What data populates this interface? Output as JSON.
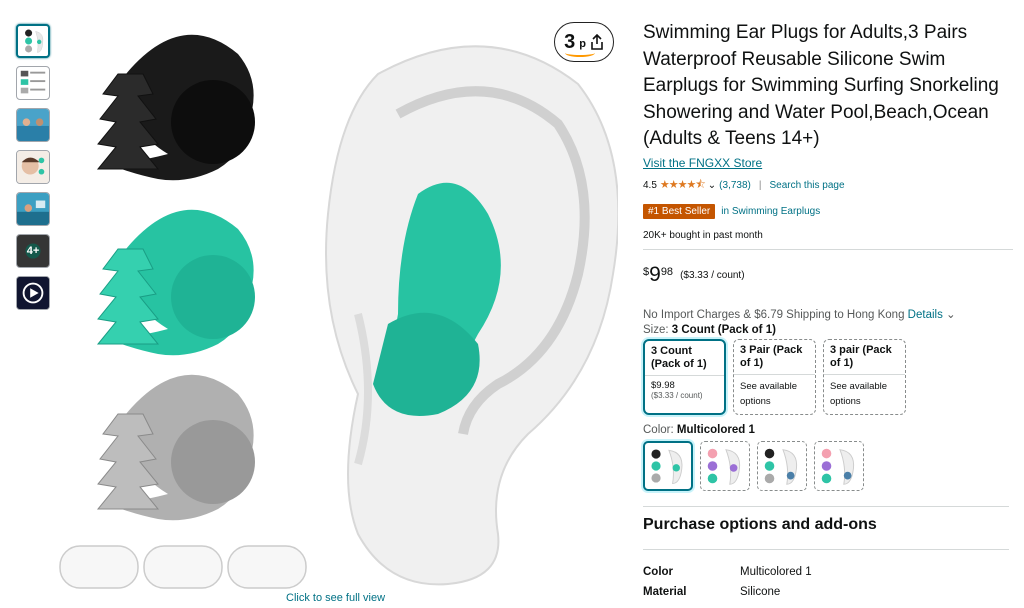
{
  "thumbnails": [
    {
      "name": "thumbnail-1",
      "type": "image"
    },
    {
      "name": "thumbnail-2",
      "type": "image"
    },
    {
      "name": "thumbnail-3",
      "type": "image"
    },
    {
      "name": "thumbnail-4",
      "type": "image"
    },
    {
      "name": "thumbnail-5",
      "type": "image"
    },
    {
      "name": "thumbnail-more",
      "type": "more",
      "label": "4+"
    },
    {
      "name": "thumbnail-video",
      "type": "video"
    }
  ],
  "main_image": {
    "see_full_label": "Click to see full view",
    "share_count": "3",
    "share_suffix": "p"
  },
  "product": {
    "title": "Swimming Ear Plugs for Adults,3 Pairs Waterproof Reusable Silicone Swim Earplugs for Swimming Surfing Snorkeling Showering and Water Pool,Beach,Ocean (Adults & Teens 14+)",
    "store_link": "Visit the FNGXX Store",
    "rating": "4.5",
    "stars": "★★★★⯪",
    "review_count": "(3,738)",
    "search_page": "Search this page",
    "badge": "#1 Best Seller",
    "badge_category": "in Swimming Earplugs",
    "bought": "20K+ bought in past month",
    "price_symbol": "$",
    "price_whole": "9",
    "price_fraction": "98",
    "price_unit": "($3.33 / count)",
    "shipping": "No Import Charges & $6.79 Shipping to Hong Kong",
    "shipping_details": "Details",
    "size_prefix": "Size:",
    "size_selected": "3 Count (Pack of 1)",
    "size_options": [
      {
        "name": "3 Count (Pack of 1)",
        "price": "$9.98",
        "unit": "($3.33 / count)",
        "selected": true
      },
      {
        "name": "3 Pair (Pack of 1)",
        "avail": "See available options",
        "selected": false
      },
      {
        "name": "3 pair (Pack of 1)",
        "avail": "See available options",
        "selected": false
      }
    ],
    "color_prefix": "Color:",
    "color_selected": "Multicolored 1",
    "purchase_title": "Purchase options and add-ons",
    "attributes": [
      {
        "key": "Color",
        "value": "Multicolored 1"
      },
      {
        "key": "Material",
        "value": "Silicone"
      }
    ]
  },
  "colors": {
    "link": "#007185",
    "badge": "#c45500",
    "star": "#de7921",
    "teal_plug": "#2ec4a6",
    "black_plug": "#222222",
    "gray_plug": "#a9a9a9"
  }
}
